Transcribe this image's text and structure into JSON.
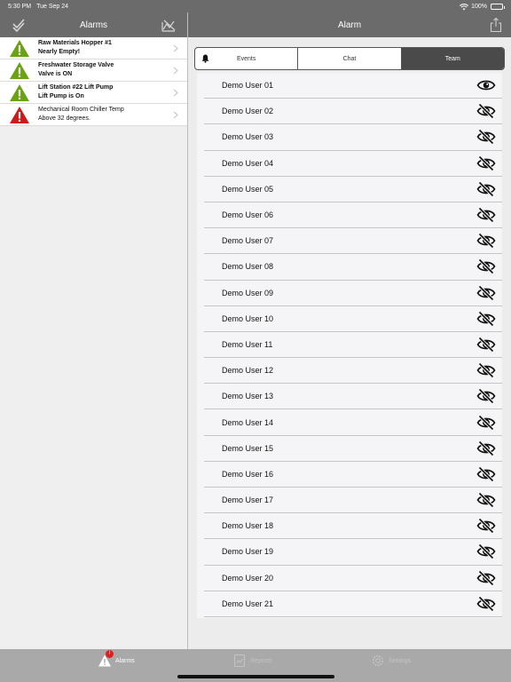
{
  "status_bar": {
    "time": "5:30 PM",
    "date": "Tue Sep 24",
    "battery": "100%"
  },
  "left": {
    "title": "Alarms",
    "alarms": [
      {
        "line1": "Raw Materials Hopper #1",
        "line2": "Nearly Empty!",
        "severity": "warning",
        "color": "#6aa312",
        "bold": true
      },
      {
        "line1": "Freshwater Storage Valve",
        "line2": "Valve is ON",
        "severity": "warning",
        "color": "#6aa312",
        "bold": true
      },
      {
        "line1": "Lift Station #22 Lift Pump",
        "line2": "Lift Pump is On",
        "severity": "warning",
        "color": "#6aa312",
        "bold": true
      },
      {
        "line1": "Mechanical Room Chiller Temp",
        "line2": "Above 32 degrees.",
        "severity": "critical",
        "color": "#d01818",
        "bold": false
      }
    ]
  },
  "right": {
    "title": "Alarm",
    "segments": [
      {
        "label": "Events",
        "icon": "bell-icon",
        "active": false
      },
      {
        "label": "Chat",
        "active": false
      },
      {
        "label": "Team",
        "active": true
      }
    ],
    "team": [
      {
        "name": "Demo User 01",
        "visible": true
      },
      {
        "name": "Demo User 02",
        "visible": false
      },
      {
        "name": "Demo User 03",
        "visible": false
      },
      {
        "name": "Demo User 04",
        "visible": false
      },
      {
        "name": "Demo User 05",
        "visible": false
      },
      {
        "name": "Demo User 06",
        "visible": false
      },
      {
        "name": "Demo User 07",
        "visible": false
      },
      {
        "name": "Demo User 08",
        "visible": false
      },
      {
        "name": "Demo User 09",
        "visible": false
      },
      {
        "name": "Demo User 10",
        "visible": false
      },
      {
        "name": "Demo User 11",
        "visible": false
      },
      {
        "name": "Demo User 12",
        "visible": false
      },
      {
        "name": "Demo User 13",
        "visible": false
      },
      {
        "name": "Demo User 14",
        "visible": false
      },
      {
        "name": "Demo User 15",
        "visible": false
      },
      {
        "name": "Demo User 16",
        "visible": false
      },
      {
        "name": "Demo User 17",
        "visible": false
      },
      {
        "name": "Demo User 18",
        "visible": false
      },
      {
        "name": "Demo User 19",
        "visible": false
      },
      {
        "name": "Demo User 20",
        "visible": false
      },
      {
        "name": "Demo User 21",
        "visible": false
      }
    ]
  },
  "tab_bar": {
    "tabs": [
      {
        "label": "Alarms",
        "icon": "alarm-triangle-icon",
        "active": true,
        "badge": "!"
      },
      {
        "label": "Reports",
        "icon": "report-icon",
        "active": false
      },
      {
        "label": "Settings",
        "icon": "gear-icon",
        "active": false
      }
    ]
  },
  "colors": {
    "header": "#6b6b6b",
    "accent_active": "#4a4a4a",
    "badge": "#e02020"
  }
}
